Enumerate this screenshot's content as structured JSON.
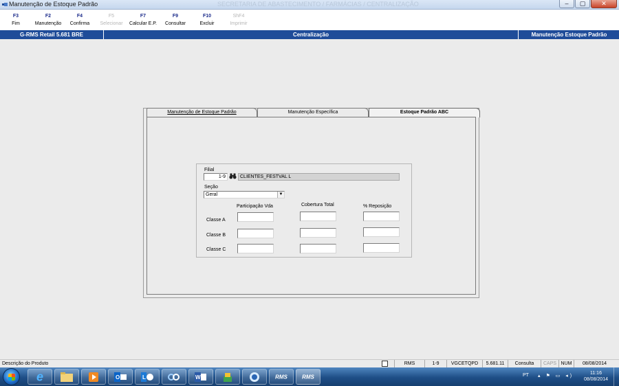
{
  "window": {
    "title": "Manutenção de Estoque Padrão",
    "ghost_title": "SECRETARIA DE ABASTECIMENTO / FARMÁCIAS / CENTRALIZAÇÃO",
    "buttons": {
      "minimize": "–",
      "maximize": "▢",
      "close": "✕"
    }
  },
  "toolbar": {
    "items": [
      {
        "key": "F3",
        "label": "Fim",
        "enabled": true
      },
      {
        "key": "F2",
        "label": "Manutenção",
        "enabled": true
      },
      {
        "key": "F4",
        "label": "Confirma",
        "enabled": true
      },
      {
        "key": "F5",
        "label": "Selecionar",
        "enabled": false
      },
      {
        "key": "F7",
        "label": "Calcular E.P.",
        "enabled": true
      },
      {
        "key": "F9",
        "label": "Consultar",
        "enabled": true
      },
      {
        "key": "F10",
        "label": "Excluir",
        "enabled": true
      },
      {
        "key": "ShF4",
        "label": "Imprimir",
        "enabled": false
      }
    ]
  },
  "header": {
    "left": "G-RMS Retail 5.681 BRE",
    "center": "Centralização",
    "right": "Manutenção Estoque Padrão"
  },
  "tabs": [
    {
      "label": "Manutenção de Estoque Padrão",
      "active": false
    },
    {
      "label": "Manutenção Específica",
      "active": false
    },
    {
      "label": "Estoque Padrão ABC",
      "active": true
    }
  ],
  "form": {
    "filial_label": "Filial",
    "filial_value": "1-9",
    "filial_name": "CLIENTES_FESTVAL L",
    "secao_label": "Seção",
    "secao_value": "Geral",
    "columns": [
      "Participação Vda",
      "Cobertura Total",
      "% Reposição"
    ],
    "rows": [
      {
        "label": "Classe A",
        "values": [
          "",
          "",
          ""
        ]
      },
      {
        "label": "Classe B",
        "values": [
          "",
          "",
          ""
        ]
      },
      {
        "label": "Classe C",
        "values": [
          "",
          "",
          ""
        ]
      }
    ]
  },
  "statusbar": {
    "description": "Descrição do Produto",
    "system": "RMS",
    "filial": "1-9",
    "program": "VGCETQPD",
    "version": "5.681.11",
    "mode": "Consulta",
    "caps": "CAPS",
    "num": "NUM",
    "date": "08/08/2014"
  },
  "taskbar": {
    "apps": [
      "ie-icon",
      "folder-icon",
      "media-icon",
      "outlook-icon",
      "lync-icon",
      "app-icon",
      "word-icon",
      "package-icon",
      "installer-icon",
      "rms-icon",
      "rms-icon"
    ],
    "rms_label": "RMS",
    "lang": "PT",
    "time": "11:16",
    "date": "08/08/2014"
  },
  "colors": {
    "header_band": "#1f4c99",
    "toolbar_key": "#1a2a8a",
    "disabled": "#b5b5b5"
  }
}
